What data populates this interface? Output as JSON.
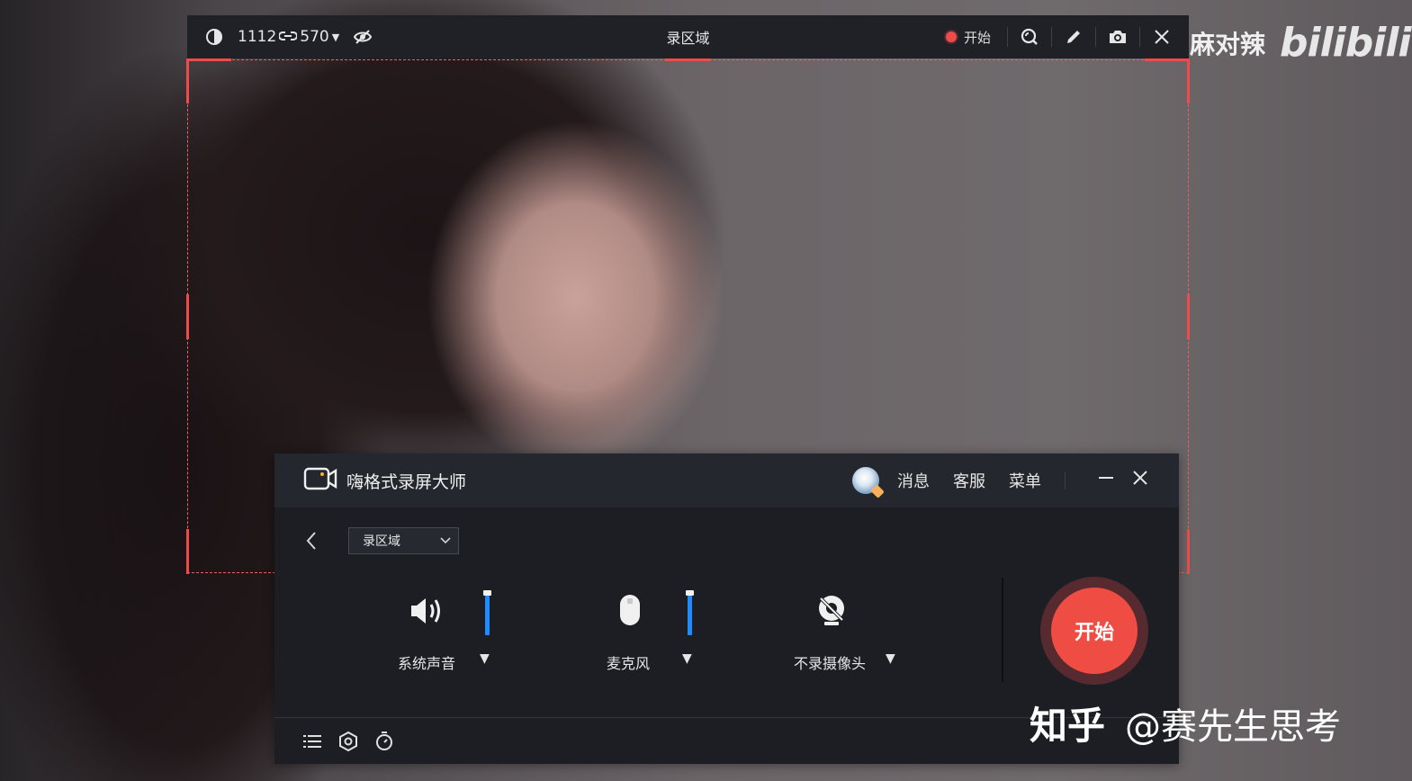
{
  "region_toolbar": {
    "width_value": "1112",
    "height_value": "570",
    "title": "录区域",
    "start_label": "开始"
  },
  "app": {
    "title": "嗨格式录屏大师",
    "header_links": [
      "消息",
      "客服",
      "菜单"
    ],
    "mode_select_value": "录区域",
    "controls": {
      "system_audio": {
        "label": "系统声音",
        "level": 1.0
      },
      "microphone": {
        "label": "麦克风",
        "level": 1.0
      },
      "camera": {
        "label": "不录摄像头"
      }
    },
    "start_button_label": "开始"
  },
  "watermarks": {
    "top_name": "麻对辣",
    "top_logo": "bilibili",
    "bottom_site": "知乎",
    "bottom_author": "@赛先生思考"
  },
  "colors": {
    "accent_red": "#ef4c44",
    "slider_blue": "#1f8bff",
    "panel_bg": "#1c1e23"
  }
}
